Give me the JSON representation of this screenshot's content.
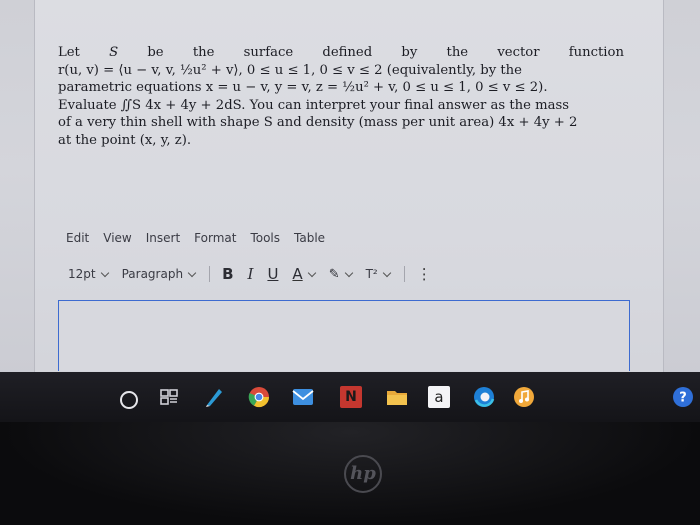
{
  "question": {
    "line1": [
      "Let",
      "S",
      "be",
      "the",
      "surface",
      "defined",
      "by",
      "the",
      "vector",
      "function"
    ],
    "line2": "r(u, v) = ⟨u − v, v, ½u² + v⟩, 0 ≤ u ≤ 1, 0 ≤ v ≤ 2 (equivalently, by the",
    "line3": "parametric equations x = u − v, y = v, z = ½u² + v, 0 ≤ u ≤ 1, 0 ≤ v ≤ 2).",
    "line4": "Evaluate ∬S 4x + 4y + 2dS. You can interpret your final answer as the mass",
    "line5": "of a very thin shell with shape S and density (mass per unit area) 4x + 4y + 2",
    "line6": "at the point (x, y, z)."
  },
  "menubar": [
    "Edit",
    "View",
    "Insert",
    "Format",
    "Tools",
    "Table"
  ],
  "toolbar": {
    "font_size": "12pt",
    "block_format": "Paragraph",
    "bold": "B",
    "italic": "I",
    "underline": "U",
    "text_color": "A",
    "highlight": "✎",
    "superscript": "T²",
    "more": "⋮"
  },
  "editor": {
    "value": ""
  },
  "taskbar_icons": [
    "launcher-icon",
    "files-icon",
    "pen-app-icon",
    "chrome-icon",
    "mail-icon",
    "news-icon",
    "folder-icon",
    "amazon-icon",
    "edge-icon",
    "music-icon",
    "help-icon"
  ],
  "colors": {
    "editor_border": "#3d6bd0",
    "taskbar": "#18181c"
  },
  "brand": {
    "bezel_logo": "hp"
  }
}
